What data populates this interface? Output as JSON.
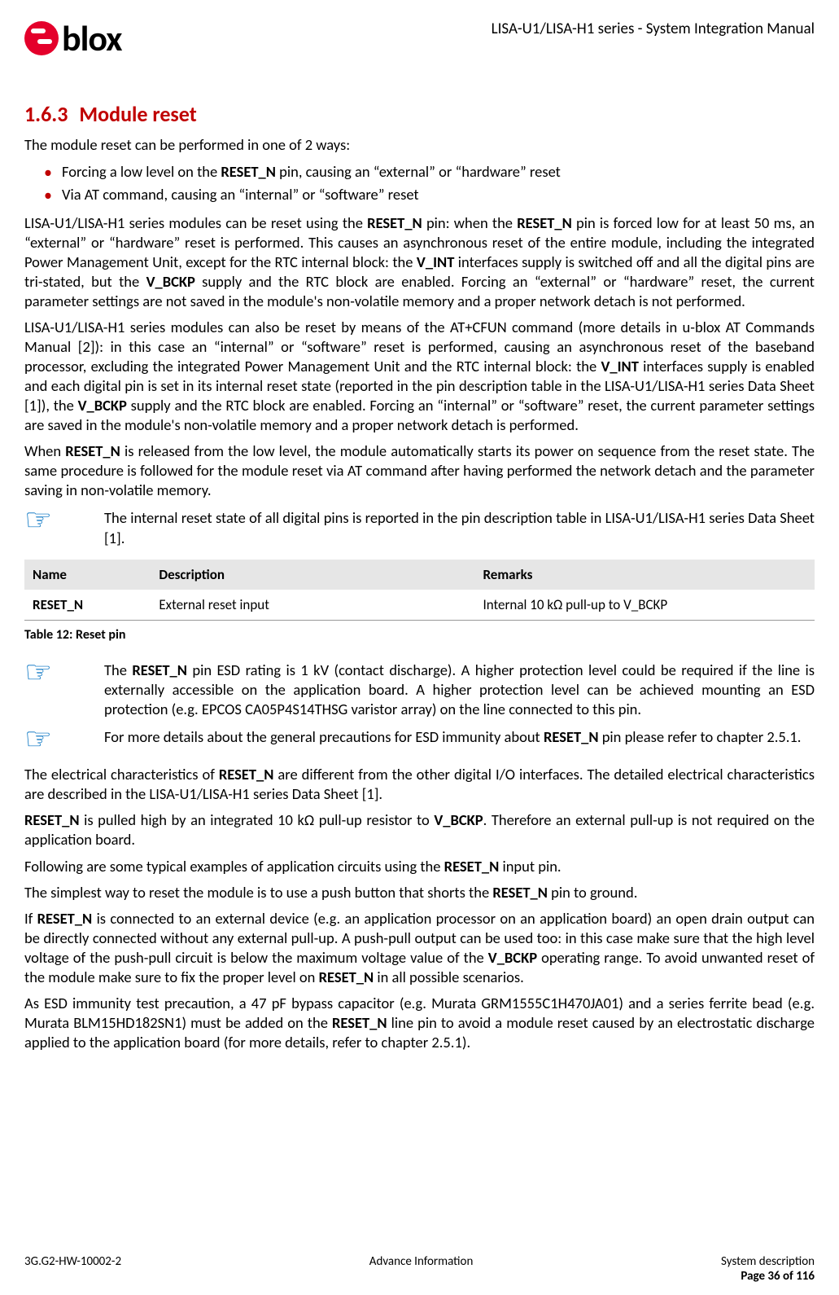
{
  "header": {
    "logo_text": "blox",
    "doc_title": "LISA-U1/LISA-H1 series - System Integration Manual"
  },
  "section": {
    "number": "1.6.3",
    "title": "Module reset"
  },
  "intro": "The module reset can be performed in one of 2 ways:",
  "bullets": [
    {
      "pre": "Forcing a low level on the ",
      "bold": "RESET_N",
      "post": " pin, causing an “external” or “hardware” reset"
    },
    {
      "pre": "Via AT command, causing an “internal” or “software” reset",
      "bold": "",
      "post": ""
    }
  ],
  "para1": {
    "s0": "LISA-U1/LISA-H1 series modules can be reset using the ",
    "b0": "RESET_N",
    "s1": " pin: when the ",
    "b1": "RESET_N",
    "s2": " pin is forced low for at least 50 ms, an “external” or “hardware” reset is performed. This causes an asynchronous reset of the entire module, including the integrated Power Management Unit, except for the RTC internal block: the ",
    "b2": "V_INT",
    "s3": " interfaces supply is switched off and all the digital pins are tri-stated, but the ",
    "b3": "V_BCKP",
    "s4": " supply and the RTC block are enabled. Forcing an “external” or “hardware” reset, the current parameter settings are not saved in the module's non-volatile memory and a proper network detach is not performed."
  },
  "para2": {
    "s0": "LISA-U1/LISA-H1 series modules can also be reset by means of the AT+CFUN command (more details in u-blox AT Commands Manual [2]): in this case an “internal” or “software” reset is performed, causing an asynchronous reset of the baseband processor, excluding the integrated Power Management Unit and the RTC internal block: the ",
    "b0": "V_INT",
    "s1": " interfaces supply is enabled and each digital pin is set in its internal reset state (reported in the pin description table in the LISA-U1/LISA-H1 series Data Sheet [1]), the ",
    "b1": "V_BCKP",
    "s2": " supply and the RTC block are enabled. Forcing an “internal” or “software” reset, the current parameter settings are saved in the module's non-volatile memory and a proper network detach is performed."
  },
  "para3": {
    "s0": "When ",
    "b0": "RESET_N",
    "s1": " is released from the low level, the module automatically starts its power on sequence from the reset state. The same procedure is followed for the module reset via AT command after having performed the network detach and the parameter saving in non-volatile memory."
  },
  "note1": "The internal reset state of all digital pins is reported in the pin description table in LISA-U1/LISA-H1 series Data Sheet [1].",
  "table": {
    "headers": [
      "Name",
      "Description",
      "Remarks"
    ],
    "row": [
      "RESET_N",
      "External reset input",
      "Internal 10 kΩ pull-up to V_BCKP"
    ],
    "caption": "Table 12: Reset pin"
  },
  "note2": {
    "s0": "The ",
    "b0": "RESET_N",
    "s1": " pin ESD rating is 1 kV (contact discharge). A higher protection level could be required if the line is externally accessible on the application board. A higher protection level can be achieved mounting an ESD protection (e.g. EPCOS CA05P4S14THSG varistor array) on the line connected to this pin."
  },
  "note3": {
    "s0": "For more details about the general precautions for ESD immunity about ",
    "b0": "RESET_N",
    "s1": " pin please refer to chapter 2.5.1."
  },
  "para4": {
    "s0": "The electrical characteristics of ",
    "b0": "RESET_N",
    "s1": " are different from the other digital I/O interfaces. The detailed electrical characteristics are described in the LISA-U1/LISA-H1 series Data Sheet [1]."
  },
  "para5": {
    "b0": "RESET_N",
    "s0": " is pulled high by an integrated 10 kΩ pull-up resistor to ",
    "b1": "V_BCKP",
    "s1": ". Therefore an external pull-up is not required on the application board."
  },
  "para6": {
    "s0": "Following are some typical examples of application circuits using the ",
    "b0": "RESET_N",
    "s1": " input pin."
  },
  "para7": {
    "s0": "The simplest way to reset the module is to use a push button that shorts the ",
    "b0": "RESET_N",
    "s1": " pin to ground."
  },
  "para8": {
    "s0": "If ",
    "b0": "RESET_N",
    "s1": " is connected to an external device (e.g. an application processor on an application board) an open drain output can be directly connected without any external pull-up. A push-pull output can be used too: in this case make sure that the high level voltage of the push-pull circuit is below the maximum voltage value of the ",
    "b1": "V_BCKP",
    "s2": " operating range. To avoid unwanted reset of the module make sure to fix the proper level on ",
    "b2": "RESET_N",
    "s3": " in all possible scenarios."
  },
  "para9": {
    "s0": "As ESD immunity test precaution, a 47 pF bypass capacitor (e.g. Murata GRM1555C1H470JA01) and a series ferrite bead (e.g. Murata BLM15HD182SN1) must be added on the ",
    "b0": "RESET_N",
    "s1": " line pin to avoid a module reset caused by an electrostatic discharge applied to the application board (for more details, refer to chapter 2.5.1)."
  },
  "footer": {
    "left": "3G.G2-HW-10002-2",
    "center": "Advance Information",
    "right_top": "System description",
    "right_bottom": "Page 36 of 116"
  }
}
